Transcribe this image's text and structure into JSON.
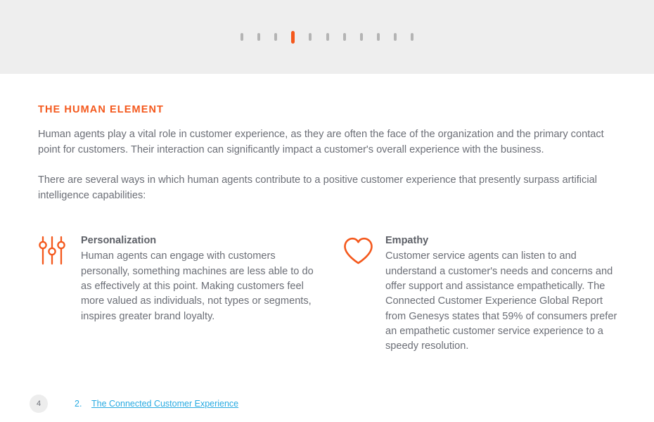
{
  "header": {
    "progress": {
      "total": 11,
      "active_index": 3,
      "active_color": "#f4581c",
      "inactive_color": "#b4b4b4",
      "band_color": "#eeeeee"
    }
  },
  "main": {
    "section_title": "THE HUMAN ELEMENT",
    "paragraph_1": "Human agents play a vital role in customer experience, as they are often the face of the organization and the primary contact point for customers. Their interaction can significantly impact a customer's overall experience with the business.",
    "paragraph_2": "There are several ways in which human agents contribute to a positive customer experience that presently surpass artificial intelligence capabilities:",
    "features": [
      {
        "icon": "sliders-icon",
        "heading": "Personalization",
        "text": "Human agents can engage with customers personally, something machines are less able to do as effectively at this point. Making customers feel more valued as individuals, not types or segments, inspires greater brand loyalty."
      },
      {
        "icon": "heart-icon",
        "heading": "Empathy",
        "text": "Customer service agents can listen to and understand a customer's needs and concerns and offer support and assistance empathetically. The Connected Customer Experience Global Report from Genesys states that 59% of consumers prefer an empathetic customer service experience to a speedy resolution."
      }
    ]
  },
  "footer": {
    "page_number": "4",
    "footnote_number": "2.",
    "footnote_link": "The Connected Customer Experience",
    "link_color": "#29abe2"
  },
  "colors": {
    "accent_orange": "#f4581c",
    "body_text": "#6b6e76",
    "heading_text": "#5d6067"
  }
}
